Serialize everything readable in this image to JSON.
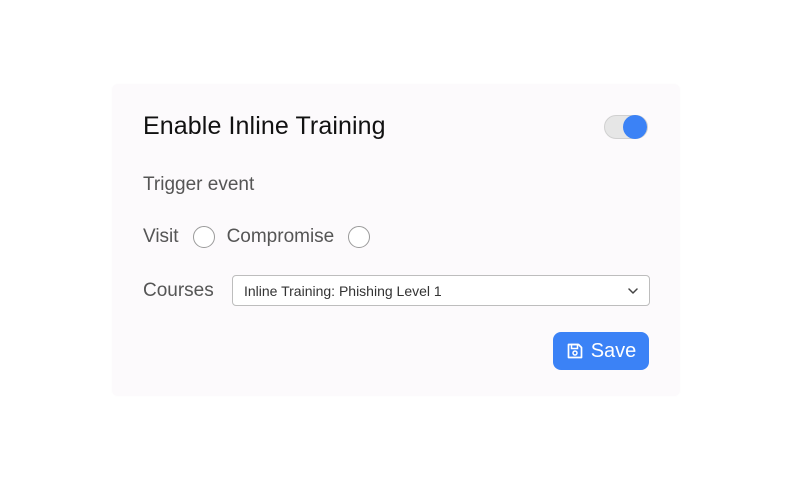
{
  "panel": {
    "title": "Enable Inline Training",
    "toggle_on": true,
    "accent_color": "#3b82f6"
  },
  "trigger": {
    "label": "Trigger event",
    "options": [
      {
        "label": "Visit",
        "selected": false
      },
      {
        "label": "Compromise",
        "selected": false
      }
    ]
  },
  "courses": {
    "label": "Courses",
    "selected_value": "Inline Training: Phishing Level 1",
    "icon": "chevron-down-icon"
  },
  "actions": {
    "save_label": "Save",
    "save_icon": "save-icon"
  }
}
